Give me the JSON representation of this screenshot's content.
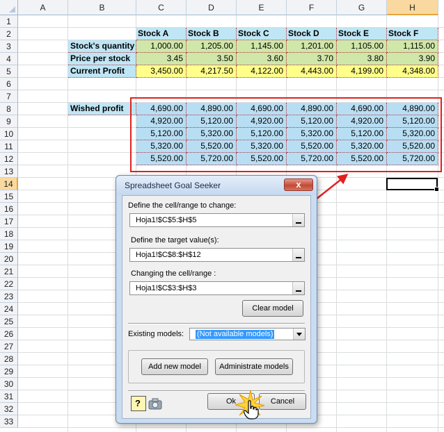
{
  "columns": [
    "A",
    "B",
    "C",
    "D",
    "E",
    "F",
    "G",
    "H"
  ],
  "rows": [
    "1",
    "2",
    "3",
    "4",
    "5",
    "6",
    "7",
    "8",
    "9",
    "10",
    "11",
    "12",
    "13",
    "14",
    "15",
    "16",
    "17",
    "18",
    "19",
    "20",
    "21",
    "22",
    "23",
    "24",
    "25",
    "26",
    "27",
    "28",
    "29",
    "30",
    "31",
    "32",
    "33"
  ],
  "table": {
    "headers": [
      "Stock A",
      "Stock B",
      "Stock C",
      "Stock D",
      "Stock E",
      "Stock F"
    ],
    "quantity_label": "Stock's quantity",
    "quantity": [
      "1,000.00",
      "1,205.00",
      "1,145.00",
      "1,201.00",
      "1,105.00",
      "1,115.00"
    ],
    "price_label": "Price per stock",
    "price": [
      "3.45",
      "3.50",
      "3.60",
      "3.70",
      "3.80",
      "3.90"
    ],
    "profit_label": "Current Profit",
    "profit": [
      "3,450.00",
      "4,217.50",
      "4,122.00",
      "4,443.00",
      "4,199.00",
      "4,348.00"
    ],
    "wished_label": "Wished profit",
    "wished": [
      [
        "4,690.00",
        "4,890.00",
        "4,690.00",
        "4,890.00",
        "4,690.00",
        "4,890.00"
      ],
      [
        "4,920.00",
        "5,120.00",
        "4,920.00",
        "5,120.00",
        "4,920.00",
        "5,120.00"
      ],
      [
        "5,120.00",
        "5,320.00",
        "5,120.00",
        "5,320.00",
        "5,120.00",
        "5,320.00"
      ],
      [
        "5,320.00",
        "5,520.00",
        "5,320.00",
        "5,520.00",
        "5,320.00",
        "5,520.00"
      ],
      [
        "5,520.00",
        "5,720.00",
        "5,520.00",
        "5,720.00",
        "5,520.00",
        "5,720.00"
      ]
    ]
  },
  "dialog": {
    "title": "Spreadsheet Goal Seeker",
    "close_glyph": "x",
    "change_label": "Define the cell/range to change:",
    "change_value": "Hoja1!$C$5:$H$5",
    "target_label": "Define the target value(s):",
    "target_value": "Hoja1!$C$8:$H$12",
    "changing_label": "Changing the cell/range :",
    "changing_value": "Hoja1!$C$3:$H$3",
    "clear_button": "Clear model",
    "existing_label": "Existing models:",
    "existing_value": "(Not available models)",
    "add_button": "Add new model",
    "admin_button": "Administrate models",
    "help_glyph": "?",
    "ok_button": "Ok",
    "cancel_button": "Cancel"
  },
  "colors": {
    "header_fill": "#bfe6f5",
    "quantity_fill": "#cfe7a8",
    "profit_fill": "#ffff8a",
    "highlight_border": "#e0211f"
  }
}
